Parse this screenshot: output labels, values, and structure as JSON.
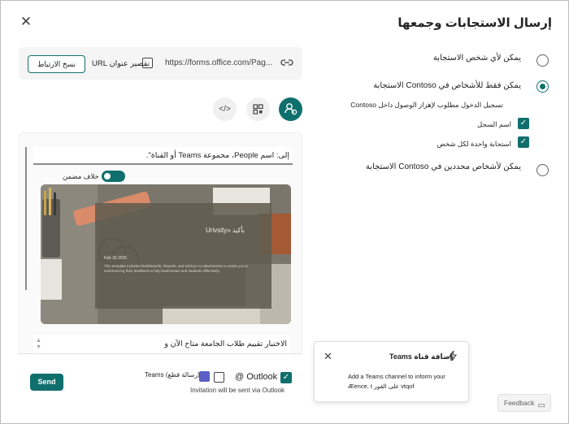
{
  "dialog": {
    "title": "إرسال الاستجابات وجمعها",
    "close_icon": "close-icon"
  },
  "audience_options": {
    "anyone": "يمكن لأي شخص الاستجابة",
    "org_only": "يمكن فقط للأشخاص في Contoso الاستجابة",
    "org_only_note": "تسجيل الدخول مطلوب لإهزاز الوصول داخل Contoso",
    "record_name": "اسم السجل",
    "one_response": "استجابة واحدة لكل شخص",
    "specific_people": "يمكن لأشخاص محددين في Contoso الاستجابة",
    "selected": "org_only"
  },
  "link": {
    "url": "https://forms.office.com/Pag...",
    "shorten_label": "تقصير عنوان URL",
    "copy_button": "نسخ الارتباط"
  },
  "share_tabs": {
    "link_icon": "link-icon",
    "qr_icon": "qr-code-icon",
    "embed_icon": "embed-code-icon",
    "embed_label": "</>"
  },
  "compose": {
    "to_text": "إلى: اسم People، مجموعة Teams أو القناة\".",
    "toggle_label": "خلاف مضمن",
    "card_title": "Urivsity» بأكيد",
    "card_date": "Feb 26 2025",
    "card_body": "This template includes Dashboards, Reports, and Stickys so attachments to assist you in summarizing their feedback to help businesses and students effectively.",
    "message_text": "الاختبار تقييم طلاب الجامعة متاح الآن و"
  },
  "send_bar": {
    "outlook_label": "@ Outlook",
    "teams_label": "Teams (رسالة قطع)",
    "note": "Invitation will be sent via Outlook",
    "send_button": "Send"
  },
  "teams_popup": {
    "title": "إضافة قناة Teams",
    "body_line1": "Add a Teams channel to inform your",
    "body_line2": "Æence, t على الفور vtqof"
  },
  "feedback": {
    "label": "Feedback"
  },
  "colors": {
    "accent": "#0f6f6d",
    "panel": "#f5f5f5"
  }
}
